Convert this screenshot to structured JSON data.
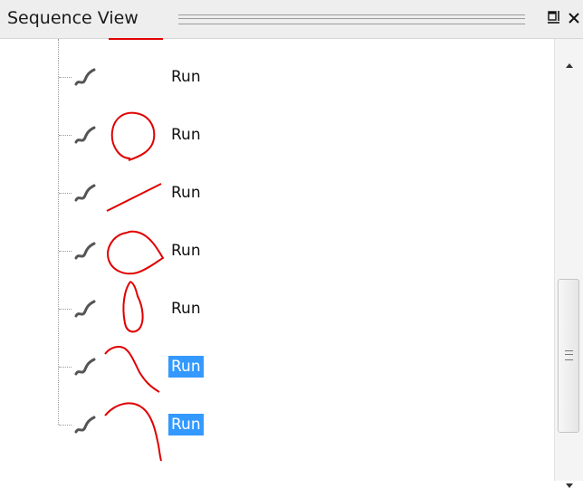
{
  "panel": {
    "title": "Sequence View"
  },
  "window_buttons": {
    "restore": "restore-icon",
    "close": "close-icon"
  },
  "colors": {
    "selection": "#3399ff",
    "stroke": "#e00000",
    "titlebar": "#eeeeee"
  },
  "rows": [
    {
      "label": "Run",
      "selected": false,
      "shape": "blank"
    },
    {
      "label": "Run",
      "selected": false,
      "shape": "loop"
    },
    {
      "label": "Run",
      "selected": false,
      "shape": "line"
    },
    {
      "label": "Run",
      "selected": false,
      "shape": "circle"
    },
    {
      "label": "Run",
      "selected": false,
      "shape": "ellipse"
    },
    {
      "label": "Run",
      "selected": true,
      "shape": "hook"
    },
    {
      "label": "Run",
      "selected": true,
      "shape": "curve"
    }
  ]
}
